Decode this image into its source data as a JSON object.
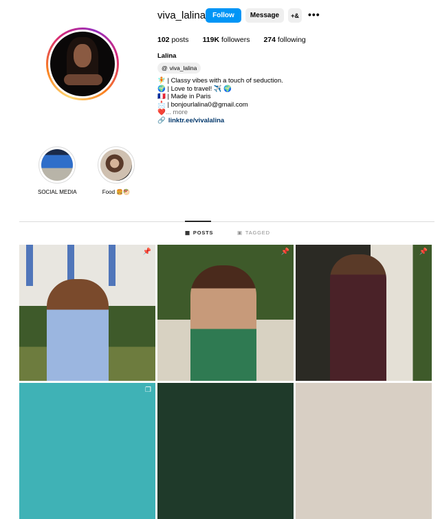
{
  "profile": {
    "username": "viva_lalina",
    "follow_label": "Follow",
    "message_label": "Message",
    "add_user_icon": "+&",
    "more_icon": "•••",
    "stats": {
      "posts_count": "102",
      "posts_label": "posts",
      "followers_count": "119K",
      "followers_label": "followers",
      "following_count": "274",
      "following_label": "following"
    },
    "full_name": "Lalina",
    "threads_handle": "viva_lalina",
    "bio": [
      "🧚 | Classy vibes with a touch of seduction.",
      "🌍 | Love to travel! ✈️ 🌍",
      "🇫🇷 | Made in Paris",
      "📩 | bonjourlalina0@gmail.com"
    ],
    "bio_more_emoji": "❤️",
    "bio_more": "... more",
    "link": "linktr.ee/vivalalina"
  },
  "highlights": [
    {
      "label": "SOCIAL MEDIA"
    },
    {
      "label": "Food 🍔🥙"
    }
  ],
  "tabs": [
    {
      "label": "POSTS",
      "icon": "grid-icon",
      "active": true
    },
    {
      "label": "TAGGED",
      "icon": "tagged-icon",
      "active": false
    }
  ],
  "posts": [
    {
      "pinned": true
    },
    {
      "pinned": true
    },
    {
      "pinned": true
    },
    {
      "pinned": false,
      "multi": true
    },
    {
      "pinned": false
    },
    {
      "pinned": false
    }
  ]
}
